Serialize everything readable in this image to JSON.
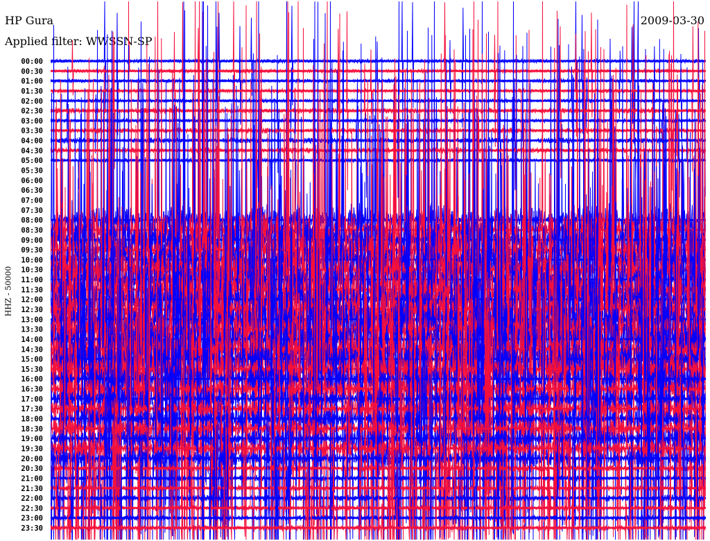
{
  "header": {
    "station": "HP Gura",
    "date": "2009-03-30",
    "filter_label": "Applied filter: WWSSN-SP"
  },
  "chart_data": {
    "type": "line",
    "title": "HP Gura",
    "subtitle": "Applied filter: WWSSN-SP",
    "ylabel": "HHZ - 50000",
    "xlabel": "",
    "row_minutes": 30,
    "colors": [
      "#0000ff",
      "#f5103c"
    ],
    "rows": [
      "00:00",
      "00:30",
      "01:00",
      "01:30",
      "02:00",
      "02:30",
      "03:00",
      "03:30",
      "04:00",
      "04:30",
      "05:00",
      "05:30",
      "06:00",
      "06:30",
      "07:00",
      "07:30",
      "08:00",
      "08:30",
      "09:00",
      "09:30",
      "10:00",
      "10:30",
      "11:00",
      "11:30",
      "12:00",
      "12:30",
      "13:00",
      "13:30",
      "14:00",
      "14:30",
      "15:00",
      "15:30",
      "16:00",
      "16:30",
      "17:00",
      "17:30",
      "18:00",
      "18:30",
      "19:00",
      "19:30",
      "20:00",
      "20:30",
      "21:00",
      "21:30",
      "22:00",
      "22:30",
      "23:00",
      "23:30"
    ],
    "activity": [
      0.05,
      0.05,
      0.05,
      0.05,
      0.05,
      0.08,
      0.05,
      0.08,
      0.08,
      0.08,
      0.05,
      0,
      0,
      0,
      0,
      0,
      0.6,
      0.7,
      0.8,
      0.8,
      0.8,
      0.8,
      0.8,
      0.8,
      0.8,
      0.8,
      0.8,
      0.8,
      0.8,
      0.8,
      0.7,
      0.7,
      0.5,
      0.4,
      0.35,
      0.35,
      0.35,
      0.35,
      0.35,
      0.35,
      0.3,
      0.1,
      0.08,
      0.08,
      0.1,
      0.08,
      0.08,
      0.08
    ],
    "spike_rate": [
      0.01,
      0.01,
      0.01,
      0.01,
      0.01,
      0.01,
      0.01,
      0.01,
      0.01,
      0.01,
      0.01,
      0,
      0,
      0,
      0,
      0,
      0.06,
      0.06,
      0.06,
      0.06,
      0.06,
      0.06,
      0.06,
      0.06,
      0.06,
      0.06,
      0.06,
      0.06,
      0.06,
      0.06,
      0.06,
      0.06,
      0.05,
      0.05,
      0.05,
      0.05,
      0.05,
      0.05,
      0.05,
      0.05,
      0.05,
      0.05,
      0.05,
      0.05,
      0.05,
      0.05,
      0.05,
      0.05
    ]
  }
}
